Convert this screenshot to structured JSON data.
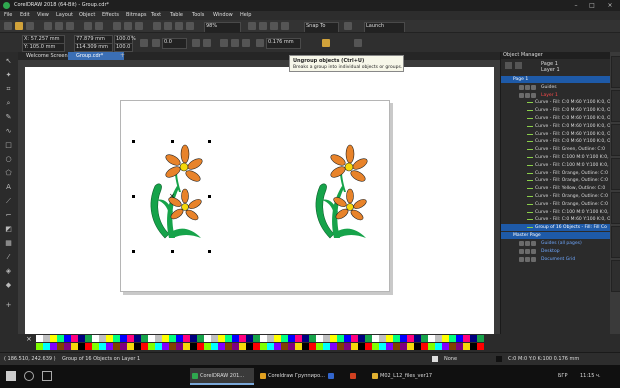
{
  "window": {
    "title": "CorelDRAW 2018 (64-Bit) - Group.cdr*"
  },
  "menu": [
    "File",
    "Edit",
    "View",
    "Layout",
    "Object",
    "Effects",
    "Bitmaps",
    "Text",
    "Table",
    "Tools",
    "Window",
    "Help"
  ],
  "toolbar": {
    "zoom": "98%",
    "snap_to": "Snap To",
    "launch": "Launch"
  },
  "propbar": {
    "x": "X: 57.257 mm",
    "y": "Y: 105.0 mm",
    "w": "77.879 mm",
    "h": "114.309 mm",
    "sx": "100.0",
    "sy": "100.0",
    "pct": "%",
    "rotation": "0.0",
    "outline": "0.176 mm"
  },
  "tabs": {
    "welcome": "Welcome Screen",
    "doc": "Group.cdr*"
  },
  "tooltip": {
    "title": "Ungroup objects (Ctrl+U)",
    "desc": "Breaks a group into individual objects or groups."
  },
  "object_manager": {
    "title": "Object Manager",
    "page_label": "Page 1",
    "layer_label": "Layer 1",
    "rows": [
      {
        "text": "Page 1",
        "kind": "page"
      },
      {
        "text": "Guides",
        "kind": "layer"
      },
      {
        "text": "Layer 1",
        "kind": "layer-red"
      },
      {
        "text": "Curve - Fill: C:0 M:60 Y:100 K:0, O",
        "kind": "item"
      },
      {
        "text": "Curve - Fill: C:0 M:60 Y:100 K:0, O",
        "kind": "item"
      },
      {
        "text": "Curve - Fill: C:0 M:60 Y:100 K:0, O",
        "kind": "item"
      },
      {
        "text": "Curve - Fill: C:0 M:60 Y:100 K:0, O",
        "kind": "item"
      },
      {
        "text": "Curve - Fill: C:0 M:60 Y:100 K:0, O",
        "kind": "item"
      },
      {
        "text": "Curve - Fill: C:0 M:60 Y:100 K:0, O",
        "kind": "item"
      },
      {
        "text": "Curve - Fill: Green, Outline: C:0",
        "kind": "item"
      },
      {
        "text": "Curve - Fill: C:100 M:0 Y:100 K:0,",
        "kind": "item"
      },
      {
        "text": "Curve - Fill: C:100 M:0 Y:100 K:0,",
        "kind": "item"
      },
      {
        "text": "Curve - Fill: Orange, Outline: C:0",
        "kind": "item"
      },
      {
        "text": "Curve - Fill: Orange, Outline: C:0",
        "kind": "item"
      },
      {
        "text": "Curve - Fill: Yellow, Outline: C:0",
        "kind": "item"
      },
      {
        "text": "Curve - Fill: Orange, Outline: C:0",
        "kind": "item"
      },
      {
        "text": "Curve - Fill: Orange, Outline: C:0",
        "kind": "item"
      },
      {
        "text": "Curve - Fill: C:100 M:0 Y:100 K:0,",
        "kind": "item"
      },
      {
        "text": "Curve - Fill: C:0 M:60 Y:100 K:0, O",
        "kind": "item"
      },
      {
        "text": "Group of 16 Objects - Fill: Fill Co",
        "kind": "item-sel"
      },
      {
        "text": "Master Page",
        "kind": "page"
      },
      {
        "text": "Guides (all pages)",
        "kind": "layer-blue"
      },
      {
        "text": "Desktop",
        "kind": "layer-blue"
      },
      {
        "text": "Document Grid",
        "kind": "layer-blue"
      }
    ]
  },
  "status": {
    "coords": "( 186.510, 242.639 )",
    "selection": "Group of 16 Objects on Layer 1",
    "fill": "None",
    "outline": "C:0 M:0 Y:0 K:100  0.176 mm"
  },
  "taskbar": {
    "items": [
      {
        "label": "CorelDRAW 201...",
        "color": "#2fa84f",
        "active": true
      },
      {
        "label": "Coreldraw Группиро...",
        "color": "#e0a020",
        "active": false
      },
      {
        "label": "",
        "color": "#3366cc",
        "active": false
      },
      {
        "label": "",
        "color": "#d04020",
        "active": false
      },
      {
        "label": "M02_L12_files_ver17",
        "color": "#e0b030",
        "active": false
      }
    ],
    "lang": "БГР",
    "time": "11:15 ч."
  },
  "colors": {
    "orange": "#e8832a",
    "green": "#16a34a",
    "yellow": "#f5d90a",
    "accent": "#1e5aa8"
  }
}
